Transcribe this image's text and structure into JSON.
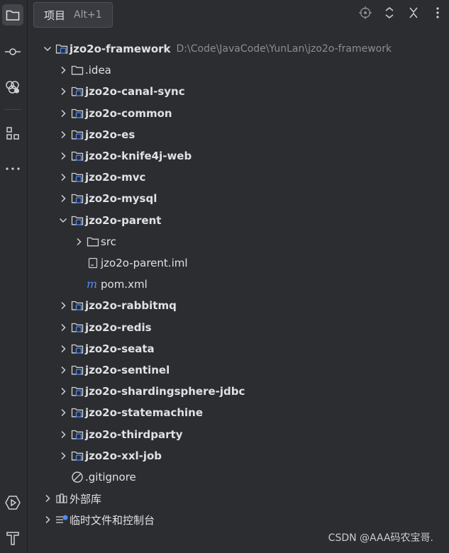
{
  "tooltip": {
    "label": "项目",
    "shortcut": "Alt+1"
  },
  "sidebar": {
    "items": [
      {
        "name": "project-icon",
        "active": true
      },
      {
        "name": "commit-icon",
        "active": false
      },
      {
        "name": "plugins-icon",
        "active": false
      },
      {
        "name": "structure-icon",
        "active": false
      },
      {
        "name": "more-icon",
        "active": false
      },
      {
        "name": "run-icon",
        "active": false
      },
      {
        "name": "build-icon",
        "active": false
      }
    ]
  },
  "header": {
    "actions": [
      "locate-icon",
      "expand-collapse-icon",
      "close-icon",
      "options-icon"
    ]
  },
  "tree": {
    "root": {
      "label": "jzo2o-framework",
      "path": "D:\\Code\\JavaCode\\YunLan\\jzo2o-framework"
    },
    "rows": [
      {
        "label": "jzo2o-framework",
        "depth": 0,
        "expanded": true,
        "type": "module",
        "path": "D:\\Code\\JavaCode\\YunLan\\jzo2o-framework"
      },
      {
        "label": ".idea",
        "depth": 1,
        "expanded": false,
        "type": "folder"
      },
      {
        "label": "jzo2o-canal-sync",
        "depth": 1,
        "expanded": false,
        "type": "module"
      },
      {
        "label": "jzo2o-common",
        "depth": 1,
        "expanded": false,
        "type": "module"
      },
      {
        "label": "jzo2o-es",
        "depth": 1,
        "expanded": false,
        "type": "module"
      },
      {
        "label": "jzo2o-knife4j-web",
        "depth": 1,
        "expanded": false,
        "type": "module"
      },
      {
        "label": "jzo2o-mvc",
        "depth": 1,
        "expanded": false,
        "type": "module"
      },
      {
        "label": "jzo2o-mysql",
        "depth": 1,
        "expanded": false,
        "type": "module"
      },
      {
        "label": "jzo2o-parent",
        "depth": 1,
        "expanded": true,
        "type": "module"
      },
      {
        "label": "src",
        "depth": 2,
        "expanded": false,
        "type": "folder"
      },
      {
        "label": "jzo2o-parent.iml",
        "depth": 2,
        "expanded": null,
        "type": "iml"
      },
      {
        "label": "pom.xml",
        "depth": 2,
        "expanded": null,
        "type": "maven"
      },
      {
        "label": "jzo2o-rabbitmq",
        "depth": 1,
        "expanded": false,
        "type": "module"
      },
      {
        "label": "jzo2o-redis",
        "depth": 1,
        "expanded": false,
        "type": "module"
      },
      {
        "label": "jzo2o-seata",
        "depth": 1,
        "expanded": false,
        "type": "module"
      },
      {
        "label": "jzo2o-sentinel",
        "depth": 1,
        "expanded": false,
        "type": "module"
      },
      {
        "label": "jzo2o-shardingsphere-jdbc",
        "depth": 1,
        "expanded": false,
        "type": "module"
      },
      {
        "label": "jzo2o-statemachine",
        "depth": 1,
        "expanded": false,
        "type": "module"
      },
      {
        "label": "jzo2o-thirdparty",
        "depth": 1,
        "expanded": false,
        "type": "module"
      },
      {
        "label": "jzo2o-xxl-job",
        "depth": 1,
        "expanded": false,
        "type": "module"
      },
      {
        "label": ".gitignore",
        "depth": 1,
        "expanded": null,
        "type": "ignore"
      },
      {
        "label": "外部库",
        "depth": 0,
        "expanded": false,
        "type": "library"
      },
      {
        "label": "临时文件和控制台",
        "depth": 0,
        "expanded": false,
        "type": "scratch"
      }
    ]
  },
  "watermark": "CSDN @AAA码农宝哥."
}
